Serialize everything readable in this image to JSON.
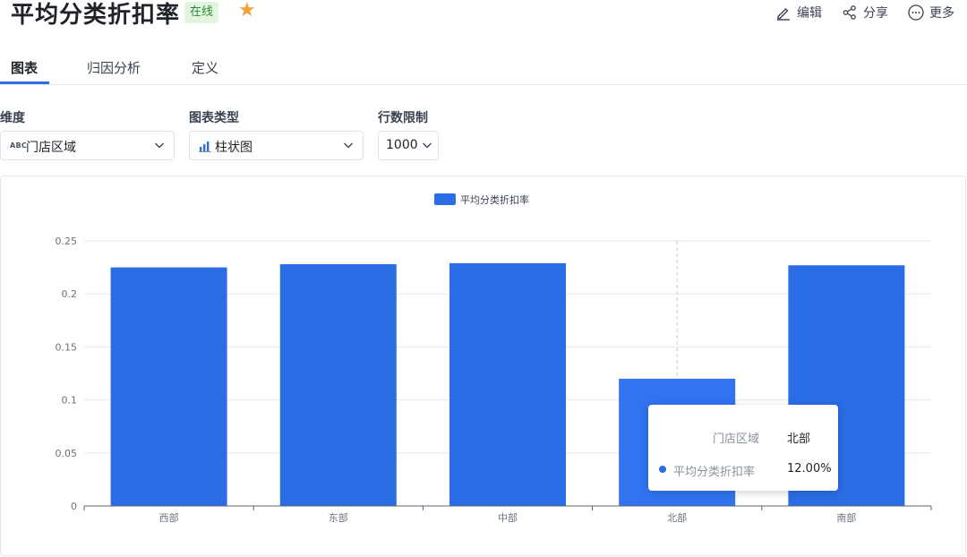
{
  "header": {
    "title": "平均分类折扣率",
    "status_badge": "在线",
    "actions": {
      "edit": "编辑",
      "share": "分享",
      "more": "更多"
    }
  },
  "tabs": [
    {
      "label": "图表",
      "active": true
    },
    {
      "label": "归因分析",
      "active": false
    },
    {
      "label": "定义",
      "active": false
    }
  ],
  "controls": {
    "dimension": {
      "label": "维度",
      "type_tag": "ABC",
      "value": "门店区域"
    },
    "chart_type": {
      "label": "图表类型",
      "value": "柱状图"
    },
    "row_limit": {
      "label": "行数限制",
      "value": "1000"
    }
  },
  "tooltip": {
    "dim_key": "门店区域",
    "dim_value": "北部",
    "metric_key": "平均分类折扣率",
    "metric_value": "12.00%"
  },
  "colors": {
    "accent": "#2b6de5",
    "bar": "#2b6de5",
    "bar_hover": "#3173f0"
  },
  "chart_data": {
    "type": "bar",
    "categories": [
      "西部",
      "东部",
      "中部",
      "北部",
      "南部"
    ],
    "series": [
      {
        "name": "平均分类折扣率",
        "values": [
          0.225,
          0.228,
          0.229,
          0.12,
          0.227
        ]
      }
    ],
    "ylim": [
      0,
      0.25
    ],
    "yticks": [
      "0",
      "0.05",
      "0.1",
      "0.15",
      "0.2",
      "0.25"
    ],
    "highlighted_category": "北部",
    "legend_position": "top-center",
    "grid": true
  }
}
